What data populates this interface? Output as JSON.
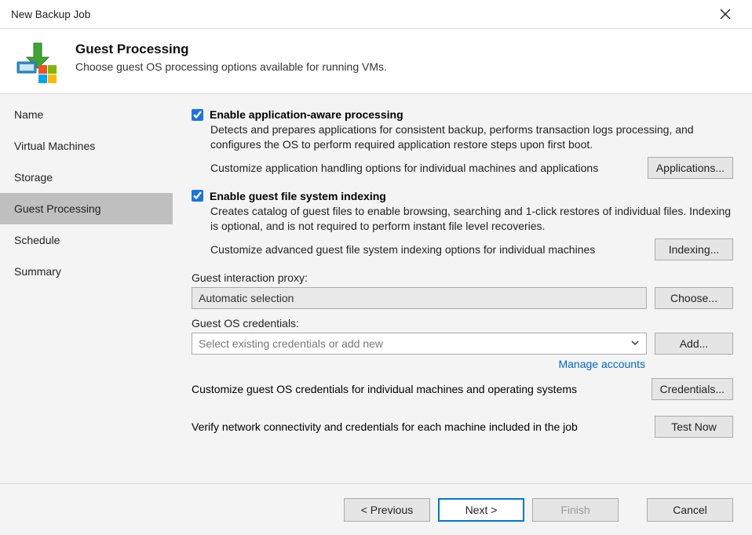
{
  "window": {
    "title": "New Backup Job"
  },
  "header": {
    "title": "Guest Processing",
    "subtitle": "Choose guest OS processing options available for running VMs."
  },
  "sidebar": {
    "items": [
      {
        "label": "Name"
      },
      {
        "label": "Virtual Machines"
      },
      {
        "label": "Storage"
      },
      {
        "label": "Guest Processing"
      },
      {
        "label": "Schedule"
      },
      {
        "label": "Summary"
      }
    ],
    "active_index": 3
  },
  "options": {
    "app_aware": {
      "title": "Enable application-aware processing",
      "desc": "Detects and prepares applications for consistent backup, performs transaction logs processing, and configures the OS to perform required application restore steps upon first boot.",
      "sub": "Customize application handling options for individual machines and applications",
      "button": "Applications..."
    },
    "indexing": {
      "title": "Enable guest file system indexing",
      "desc": "Creates catalog of guest files to enable browsing, searching and 1-click restores of individual files. Indexing is optional, and is not required to perform instant file level recoveries.",
      "sub": "Customize advanced guest file system indexing options for individual machines",
      "button": "Indexing..."
    }
  },
  "proxy": {
    "label": "Guest interaction proxy:",
    "value": "Automatic selection",
    "choose": "Choose..."
  },
  "creds": {
    "label": "Guest OS credentials:",
    "placeholder": "Select existing credentials or add new",
    "add": "Add...",
    "manage": "Manage accounts",
    "customize_text": "Customize guest OS credentials for individual machines and operating systems",
    "credentials_btn": "Credentials..."
  },
  "verify": {
    "text": "Verify network connectivity and credentials for each machine included in the job",
    "button": "Test Now"
  },
  "footer": {
    "previous": "< Previous",
    "next": "Next >",
    "finish": "Finish",
    "cancel": "Cancel"
  }
}
